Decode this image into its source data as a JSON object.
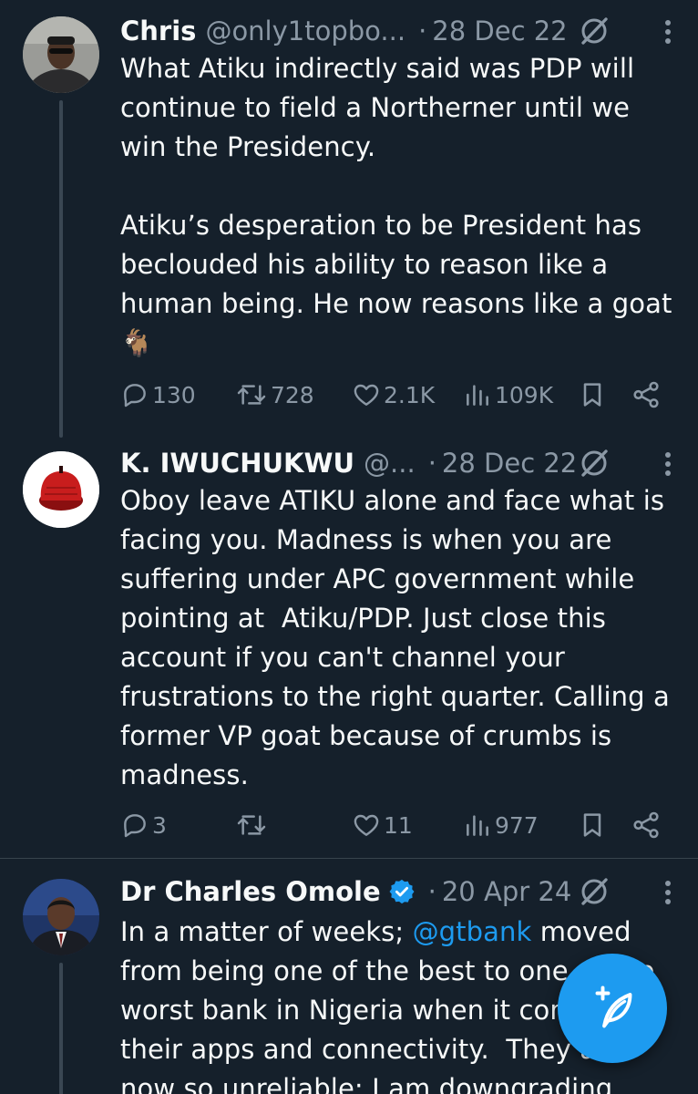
{
  "tweets": [
    {
      "name": "Chris",
      "handle": "@only1topbo...",
      "separator": "·",
      "date": "28 Dec 22",
      "text": "What Atiku indirectly said was PDP will\ncontinue to field a Northerner until we\nwin the Presidency.\n\nAtiku’s desperation to be President has\nbeclouded his ability to reason like a\nhuman being. He now reasons like a goat\n🐐",
      "replies": "130",
      "reposts": "728",
      "likes": "2.1K",
      "views": "109K"
    },
    {
      "name": "K. IWUCHUKWU",
      "handle": "@...",
      "separator": "·",
      "date": "28 Dec 22",
      "text": "Oboy leave ATIKU alone and face what is\nfacing you. Madness is when you are\nsuffering under APC government while\npointing at  Atiku/PDP. Just close this\naccount if you can't channel your\nfrustrations to the right quarter. Calling a\nformer VP goat because of crumbs is\nmadness.",
      "replies": "3",
      "reposts": "",
      "likes": "11",
      "views": "977"
    },
    {
      "name": "Dr Charles Omole",
      "handle": "",
      "separator": "·",
      "date": "20 Apr 24",
      "text_before": "In a matter of weeks; ",
      "mention": "@gtbank",
      "text_after": " moved\nfrom being one of the best to one of the\nworst bank in Nigeria when it comes to\ntheir apps and connectivity.  They are\nnow so unreliable; I am downgrading"
    }
  ],
  "icons": {
    "reply": "reply-icon",
    "repost": "repost-icon",
    "like": "heart-icon",
    "views": "views-icon",
    "bookmark": "bookmark-icon",
    "share": "share-icon",
    "grok": "grok-icon",
    "more": "more-vertical-icon",
    "compose": "compose-post-icon"
  },
  "colors": {
    "background": "#15202b",
    "accent": "#1d9bf0",
    "text": "#f7f9f9",
    "muted": "#8b98a5"
  }
}
